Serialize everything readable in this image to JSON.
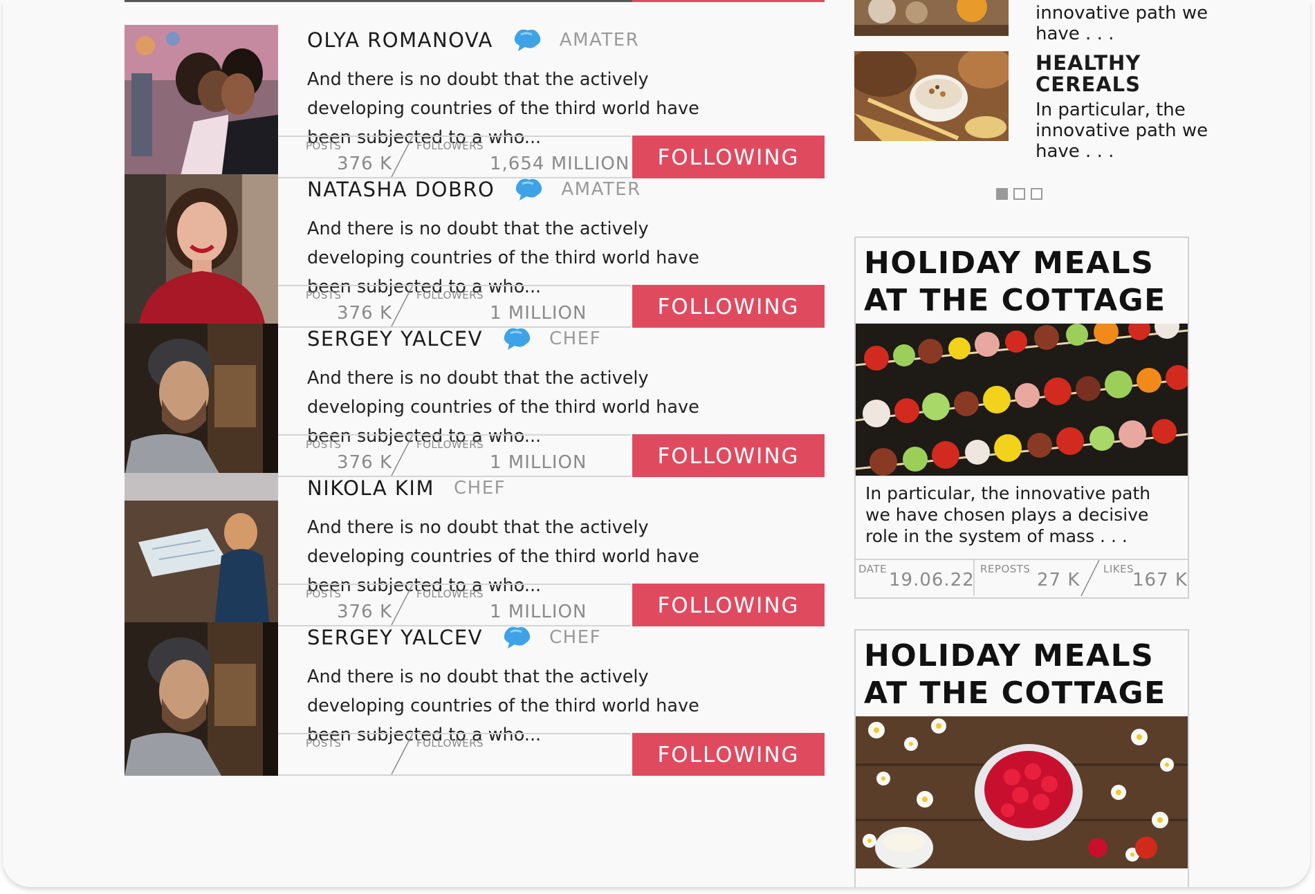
{
  "profiles": [
    {
      "name": "OLYA ROMANOVA",
      "role": "AMATER",
      "has_badge": true,
      "description": "And there is no doubt that the actively developing countries of the third world have been subjected to a who...",
      "posts_label": "POSTS",
      "posts": "376 K",
      "followers_label": "FOLLOWERS",
      "followers": "1,654 MILLION",
      "button": "FOLLOWING"
    },
    {
      "name": "NATASHA DOBRO",
      "role": "AMATER",
      "has_badge": true,
      "description": "And there is no doubt that the actively developing countries of the third world have been subjected to a who...",
      "posts_label": "POSTS",
      "posts": "376 K",
      "followers_label": "FOLLOWERS",
      "followers": "1 MILLION",
      "button": "FOLLOWING"
    },
    {
      "name": "SERGEY YALCEV",
      "role": "CHEF",
      "has_badge": true,
      "description": "And there is no doubt that the actively developing countries of the third world have been subjected to a who...",
      "posts_label": "POSTS",
      "posts": "376 K",
      "followers_label": "FOLLOWERS",
      "followers": "1 MILLION",
      "button": "FOLLOWING"
    },
    {
      "name": "NIKOLA KIM",
      "role": "CHEF",
      "has_badge": false,
      "description": "And there is no doubt that the actively developing countries of the third world have been subjected to a who...",
      "posts_label": "POSTS",
      "posts": "376 K",
      "followers_label": "FOLLOWERS",
      "followers": "1 MILLION",
      "button": "FOLLOWING"
    },
    {
      "name": "SERGEY YALCEV",
      "role": "CHEF",
      "has_badge": true,
      "description": "And there is no doubt that the actively developing countries of the third world have been subjected to a who...",
      "posts_label": "POSTS",
      "posts": "",
      "followers_label": "FOLLOWERS",
      "followers": "",
      "button": "FOLLOWING"
    }
  ],
  "sidebar": {
    "mini_1": {
      "text": "innovative path we have . . ."
    },
    "mini_2": {
      "title": "HEALTHY CEREALS",
      "text": "In particular, the innovative path we have . . ."
    },
    "carousel": {
      "total": 3,
      "active": 0
    },
    "post_1": {
      "title": "HOLIDAY MEALS AT THE COTTAGE",
      "text": "In particular, the innovative path we have chosen plays a decisive role in the system of mass . . .",
      "date_label": "DATE",
      "date": "19.06.22",
      "reposts_label": "REPOSTS",
      "reposts": "27 K",
      "likes_label": "LIKES",
      "likes": "167 K"
    },
    "post_2": {
      "title": "HOLIDAY MEALS AT THE COTTAGE"
    }
  },
  "colors": {
    "accent": "#e04a5f",
    "badge": "#3ea3e6",
    "text": "#1b1b1b",
    "muted": "#9a9a9a",
    "background": "#f9f9f9"
  },
  "icons": {
    "badge": "chat-bubble-icon"
  }
}
